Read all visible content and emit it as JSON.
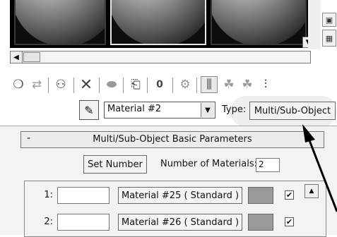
{
  "toolbar": {
    "icons": [
      "get-material-icon",
      "put-to-scene-icon",
      "assign-material-icon",
      "reset-icon",
      "make-copy-icon",
      "make-unique-icon",
      "put-to-library-icon",
      "material-id-channel-icon",
      "show-map-icon",
      "show-end-result-icon",
      "go-to-parent-icon",
      "go-forward-sibling-icon",
      "select-by-material-icon"
    ]
  },
  "material": {
    "name": "Material #2",
    "type_label": "Type:",
    "type_value": "Multi/Sub-Object"
  },
  "rollout": {
    "collapse": "-",
    "title": "Multi/Sub-Object Basic Parameters",
    "set_number_label": "Set Number",
    "num_materials_label": "Number of Materials:",
    "num_materials_value": "2"
  },
  "submaterials": [
    {
      "id": "1:",
      "name_field": "",
      "material": "Material #25  ( Standard )",
      "enabled": true
    },
    {
      "id": "2:",
      "name_field": "",
      "material": "Material #26  ( Standard )",
      "enabled": true
    }
  ],
  "colors": {
    "swatch": "#9a9a9a",
    "panel_bg": "#f3f3f3"
  }
}
